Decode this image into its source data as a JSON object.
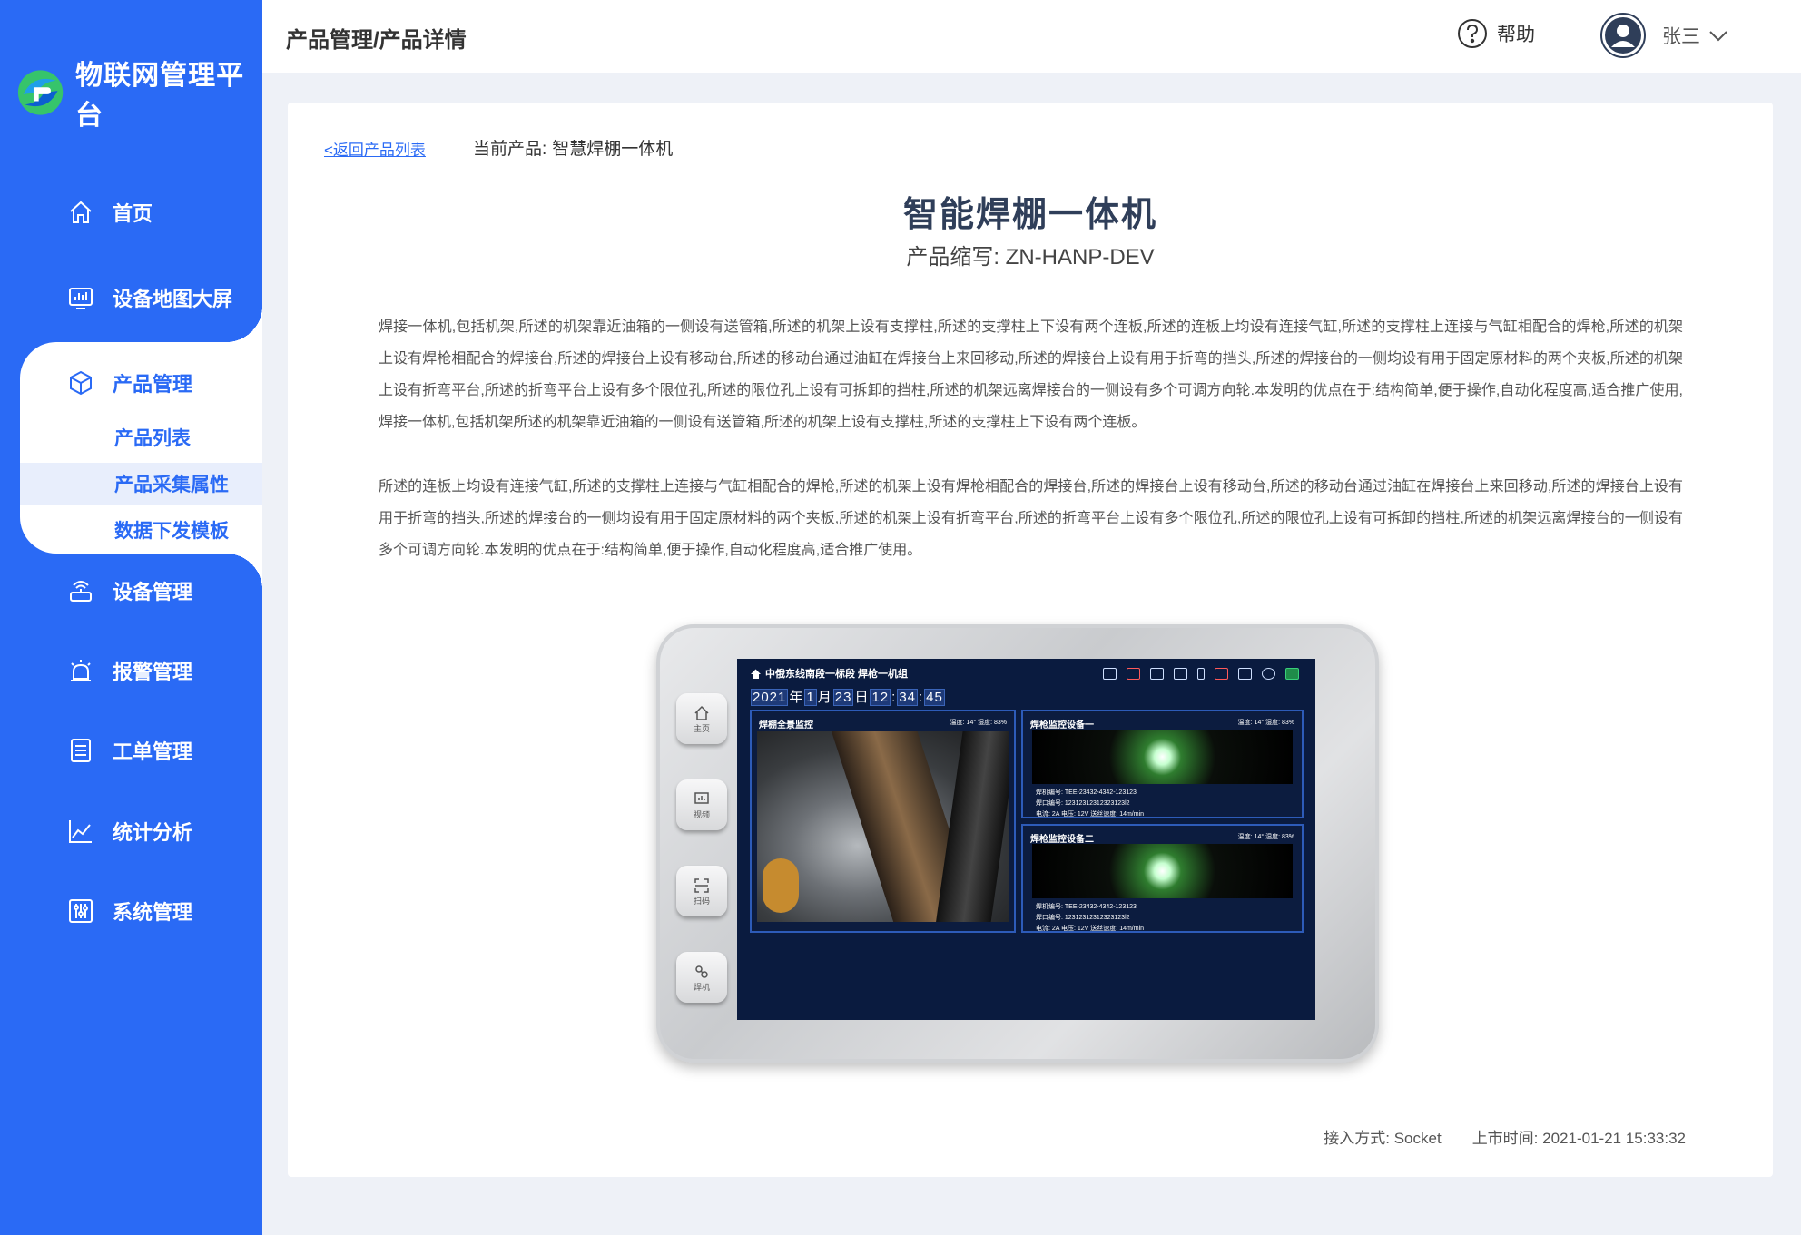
{
  "app": {
    "title": "物联网管理平台"
  },
  "nav": {
    "items": [
      {
        "label": "首页",
        "icon": "home-icon"
      },
      {
        "label": "设备地图大屏",
        "icon": "dashboard-icon"
      },
      {
        "label": "设备管理",
        "icon": "router-icon"
      },
      {
        "label": "报警管理",
        "icon": "alarm-icon"
      },
      {
        "label": "工单管理",
        "icon": "list-icon"
      },
      {
        "label": "统计分析",
        "icon": "chart-icon"
      },
      {
        "label": "系统管理",
        "icon": "settings-icon"
      }
    ],
    "group": {
      "label": "产品管理",
      "icon": "cube-icon",
      "children": [
        "产品列表",
        "产品采集属性",
        "数据下发模板"
      ],
      "active_index": 1
    }
  },
  "header": {
    "breadcrumb": "产品管理/产品详情",
    "help": "帮助",
    "user": "张三"
  },
  "detail": {
    "back_link": "<返回产品列表",
    "current_label": "当前产品:",
    "current_value": "智慧焊棚一体机",
    "title": "智能焊棚一体机",
    "abbr": "产品缩写: ZN-HANP-DEV",
    "paragraph1": "焊接一体机,包括机架,所述的机架靠近油箱的一侧设有送管箱,所述的机架上设有支撑柱,所述的支撑柱上下设有两个连板,所述的连板上均设有连接气缸,所述的支撑柱上连接与气缸相配合的焊枪,所述的机架上设有焊枪相配合的焊接台,所述的焊接台上设有移动台,所述的移动台通过油缸在焊接台上来回移动,所述的焊接台上设有用于折弯的挡头,所述的焊接台的一侧均设有用于固定原材料的两个夹板,所述的机架上设有折弯平台,所述的折弯平台上设有多个限位孔,所述的限位孔上设有可拆卸的挡柱,所述的机架远离焊接台的一侧设有多个可调方向轮.本发明的优点在于:结构简单,便于操作,自动化程度高,适合推广使用,焊接一体机,包括机架所述的机架靠近油箱的一侧设有送管箱,所述的机架上设有支撑柱,所述的支撑柱上下设有两个连板。",
    "paragraph2": "所述的连板上均设有连接气缸,所述的支撑柱上连接与气缸相配合的焊枪,所述的机架上设有焊枪相配合的焊接台,所述的焊接台上设有移动台,所述的移动台通过油缸在焊接台上来回移动,所述的焊接台上设有用于折弯的挡头,所述的焊接台的一侧均设有用于固定原材料的两个夹板,所述的机架上设有折弯平台,所述的折弯平台上设有多个限位孔,所述的限位孔上设有可拆卸的挡柱,所述的机架远离焊接台的一侧设有多个可调方向轮.本发明的优点在于:结构简单,便于操作,自动化程度高,适合推广使用。",
    "footer_access": "接入方式: Socket",
    "footer_time": "上市时间: 2021-01-21 15:33:32"
  },
  "device": {
    "buttons": [
      "主页",
      "视频",
      "扫码",
      "焊机"
    ],
    "screen_title": "中俄东线南段一标段 焊枪一机组",
    "date_parts": [
      "2021",
      "年",
      "1",
      "月",
      "23",
      "日",
      "12",
      ":",
      "34",
      ":",
      "45"
    ],
    "main_panel": {
      "title": "焊棚全景监控",
      "readout": "温度: 14°   湿度: 83%"
    },
    "side_panels": [
      {
        "title": "焊枪监控设备一",
        "readout": "温度: 14°   湿度: 83%",
        "line1": "焊机编号: TEE-23432-4342-123123",
        "line2": "焊口编号: 12312312312323123l2",
        "line3": "电流: 2A     电压: 12V     送丝速度: 14m/min"
      },
      {
        "title": "焊枪监控设备二",
        "readout": "温度: 14°   湿度: 83%",
        "line1": "焊机编号: TEE-23432-4342-123123",
        "line2": "焊口编号: 12312312312323123l2",
        "line3": "电流: 2A     电压: 12V     送丝速度: 14m/min"
      }
    ]
  },
  "colors": {
    "primary": "#2a6af5",
    "title": "#2f3e59",
    "background": "#eef1f7"
  }
}
